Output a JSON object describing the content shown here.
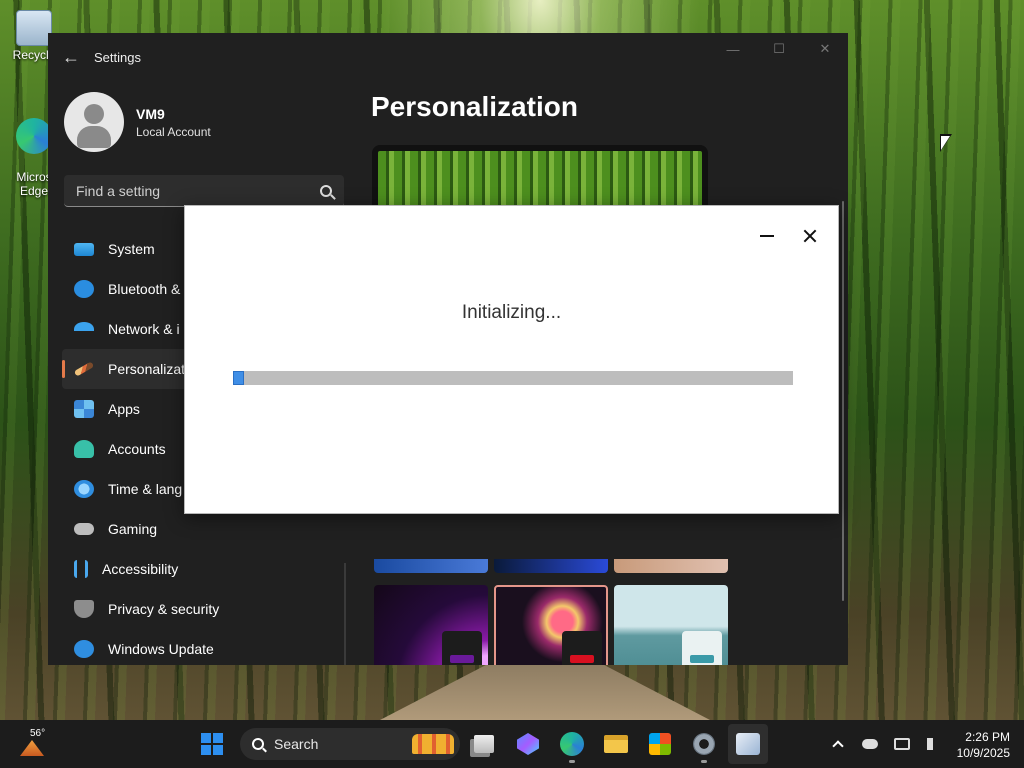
{
  "desktop": {
    "icons": [
      {
        "label": "Recycle"
      },
      {
        "label": "Micros\nEdge"
      }
    ]
  },
  "settings": {
    "title": "Settings",
    "profile": {
      "name": "VM9",
      "account_type": "Local Account"
    },
    "search_placeholder": "Find a setting",
    "nav": [
      {
        "label": "System",
        "icon": "system-icon"
      },
      {
        "label": "Bluetooth &",
        "icon": "bluetooth-icon"
      },
      {
        "label": "Network & i",
        "icon": "network-icon"
      },
      {
        "label": "Personalizati",
        "icon": "personalization-icon",
        "active": true
      },
      {
        "label": "Apps",
        "icon": "apps-icon"
      },
      {
        "label": "Accounts",
        "icon": "accounts-icon"
      },
      {
        "label": "Time & lang",
        "icon": "time-language-icon"
      },
      {
        "label": "Gaming",
        "icon": "gaming-icon"
      },
      {
        "label": "Accessibility",
        "icon": "accessibility-icon"
      },
      {
        "label": "Privacy & security",
        "icon": "shield-icon"
      },
      {
        "label": "Windows Update",
        "icon": "update-icon"
      }
    ],
    "page_title": "Personalization",
    "themes": [
      {
        "name": "theme-purple",
        "accent": "#6a1a9a"
      },
      {
        "name": "theme-flower",
        "accent": "#d81020",
        "selected": true
      },
      {
        "name": "theme-lake",
        "accent": "#3a9aa8"
      }
    ]
  },
  "dialog": {
    "status": "Initializing...",
    "progress_fraction": 0.02
  },
  "taskbar": {
    "weather_temp": "56°",
    "search_label": "Search",
    "clock_time": "2:26 PM",
    "clock_date": "10/9/2025"
  }
}
